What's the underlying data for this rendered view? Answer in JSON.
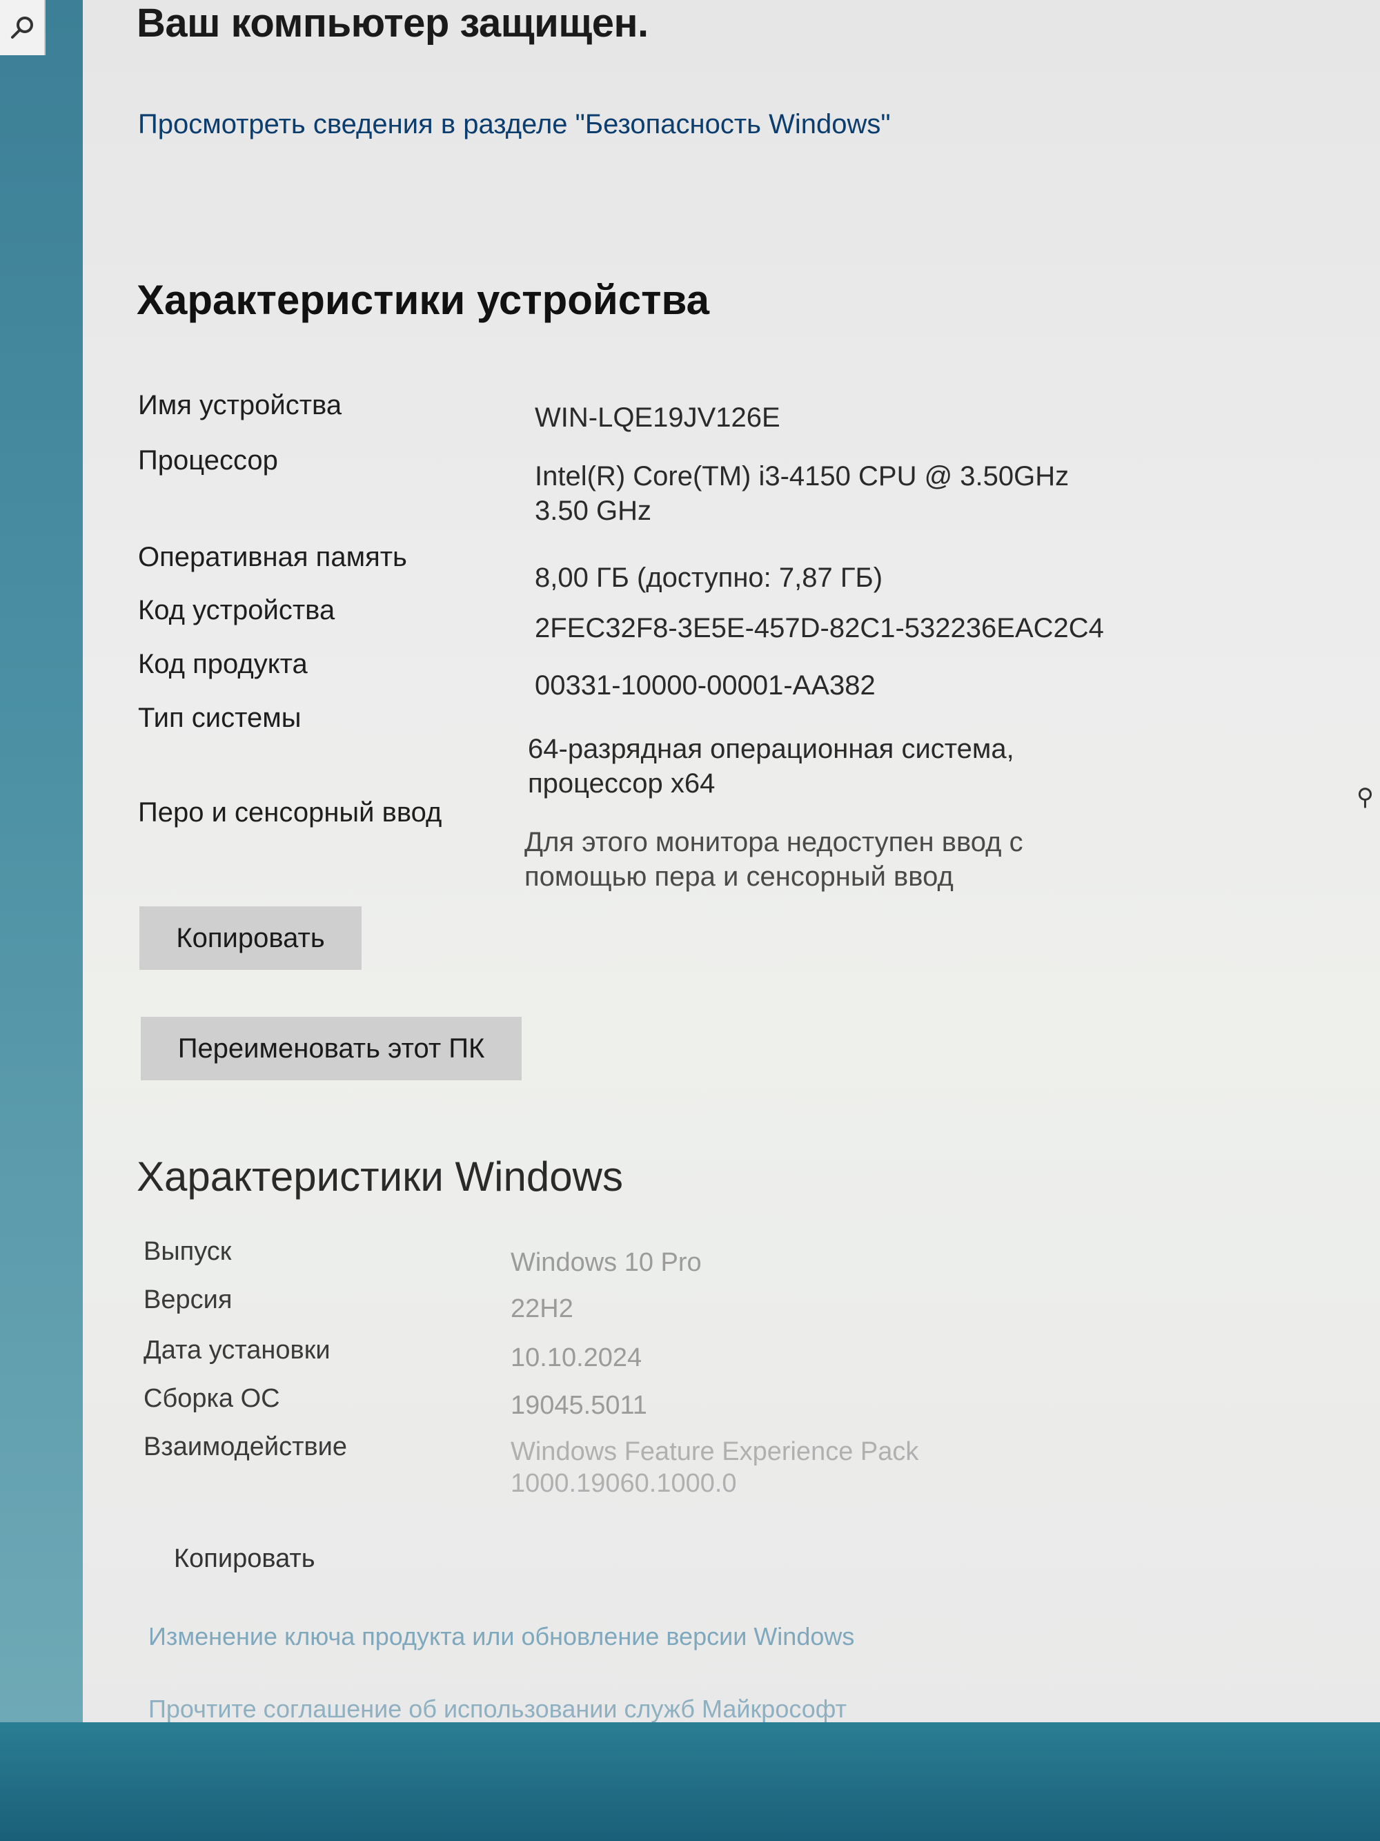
{
  "header": {
    "status_title": "Ваш компьютер защищен.",
    "security_link": "Просмотреть сведения в разделе \"Безопасность Windows\""
  },
  "device_specs": {
    "title": "Характеристики устройства",
    "rows": [
      {
        "label": "Имя устройства",
        "value": "WIN-LQE19JV126E"
      },
      {
        "label": "Процессор",
        "value": "Intel(R) Core(TM) i3-4150 CPU @ 3.50GHz 3.50 GHz"
      },
      {
        "label": "Оперативная память",
        "value": "8,00 ГБ (доступно: 7,87 ГБ)"
      },
      {
        "label": "Код устройства",
        "value": "2FEC32F8-3E5E-457D-82C1-532236EAC2C4"
      },
      {
        "label": "Код продукта",
        "value": "00331-10000-00001-AA382"
      },
      {
        "label": "Тип системы",
        "value": "64-разрядная операционная система, процессор x64"
      },
      {
        "label": "Перо и сенсорный ввод",
        "value": "Для этого монитора недоступен ввод с помощью пера и сенсорный ввод"
      }
    ],
    "copy_button": "Копировать",
    "rename_button": "Переименовать этот ПК"
  },
  "windows_specs": {
    "title": "Характеристики Windows",
    "rows": [
      {
        "label": "Выпуск",
        "value": "Windows 10 Pro"
      },
      {
        "label": "Версия",
        "value": "22H2"
      },
      {
        "label": "Дата установки",
        "value": "10.10.2024"
      },
      {
        "label": "Сборка ОС",
        "value": "19045.5011"
      },
      {
        "label": "Взаимодействие",
        "value": "Windows Feature Experience Pack 1000.19060.1000.0"
      }
    ],
    "copy_link": "Копировать"
  },
  "footer": {
    "change_key_link": "Изменение ключа продукта или обновление версии Windows",
    "agreement_link": "Прочтите соглашение об использовании служб Майкрософт"
  }
}
